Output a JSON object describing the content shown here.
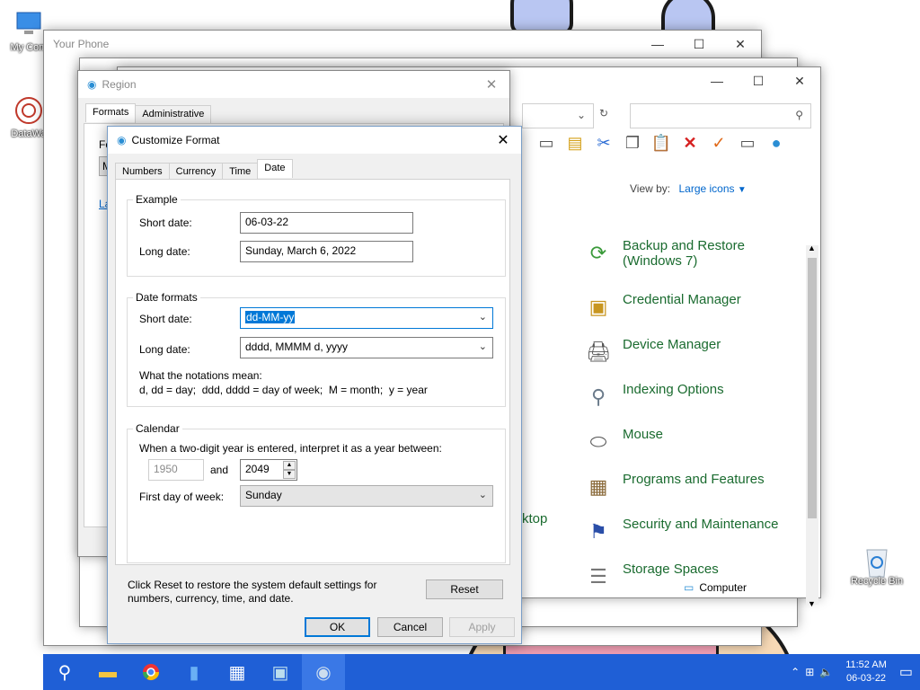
{
  "desktop": {
    "icons": [
      {
        "label": "My Com"
      },
      {
        "label": "DataWa"
      },
      {
        "label": "Recycle Bin"
      }
    ]
  },
  "your_phone": {
    "title": "Your Phone"
  },
  "control_panel": {
    "view_by_label": "View by:",
    "view_by_value": "Large icons",
    "items": [
      {
        "label": "Backup and Restore (Windows 7)",
        "icon": "backup-icon"
      },
      {
        "label": "Credential Manager",
        "icon": "credential-icon"
      },
      {
        "label": "Device Manager",
        "icon": "device-manager-icon"
      },
      {
        "label": "Indexing Options",
        "icon": "indexing-icon"
      },
      {
        "label": "Mouse",
        "icon": "mouse-icon"
      },
      {
        "label": "Programs and Features",
        "icon": "programs-icon"
      },
      {
        "label": "Security and Maintenance",
        "icon": "security-icon"
      },
      {
        "label": "Storage Spaces",
        "icon": "storage-icon"
      }
    ],
    "partial_item": "ktop",
    "status": "Computer"
  },
  "region": {
    "title": "Region",
    "tabs": [
      "Formats",
      "Administrative"
    ],
    "fragments": {
      "fo": "Fo",
      "m": "M",
      "la": "La"
    }
  },
  "customize_format": {
    "title": "Customize Format",
    "tabs": [
      "Numbers",
      "Currency",
      "Time",
      "Date"
    ],
    "active_tab": "Date",
    "example": {
      "title": "Example",
      "short_date_label": "Short date:",
      "short_date_value": "06-03-22",
      "long_date_label": "Long date:",
      "long_date_value": "Sunday, March 6, 2022"
    },
    "date_formats": {
      "title": "Date formats",
      "short_date_label": "Short date:",
      "short_date_value": "dd-MM-yy",
      "long_date_label": "Long date:",
      "long_date_value": "dddd, MMMM d, yyyy",
      "notation_title": "What the notations mean:",
      "notation_text": "d, dd = day;  ddd, dddd = day of week;  M = month;  y = year"
    },
    "calendar": {
      "title": "Calendar",
      "two_digit_text": "When a two-digit year is entered, interpret it as a year between:",
      "year_start": "1950",
      "and_label": "and",
      "year_end": "2049",
      "first_day_label": "First day of week:",
      "first_day_value": "Sunday"
    },
    "reset_text": "Click Reset to restore the system default settings for numbers, currency, time, and date.",
    "reset_button": "Reset",
    "ok_button": "OK",
    "cancel_button": "Cancel",
    "apply_button": "Apply"
  },
  "taskbar": {
    "time": "11:52 AM",
    "date": "06-03-22"
  },
  "colors": {
    "taskbar": "#1f5fd6",
    "accent": "#0078d7",
    "cp_link": "#1a6b2f"
  }
}
